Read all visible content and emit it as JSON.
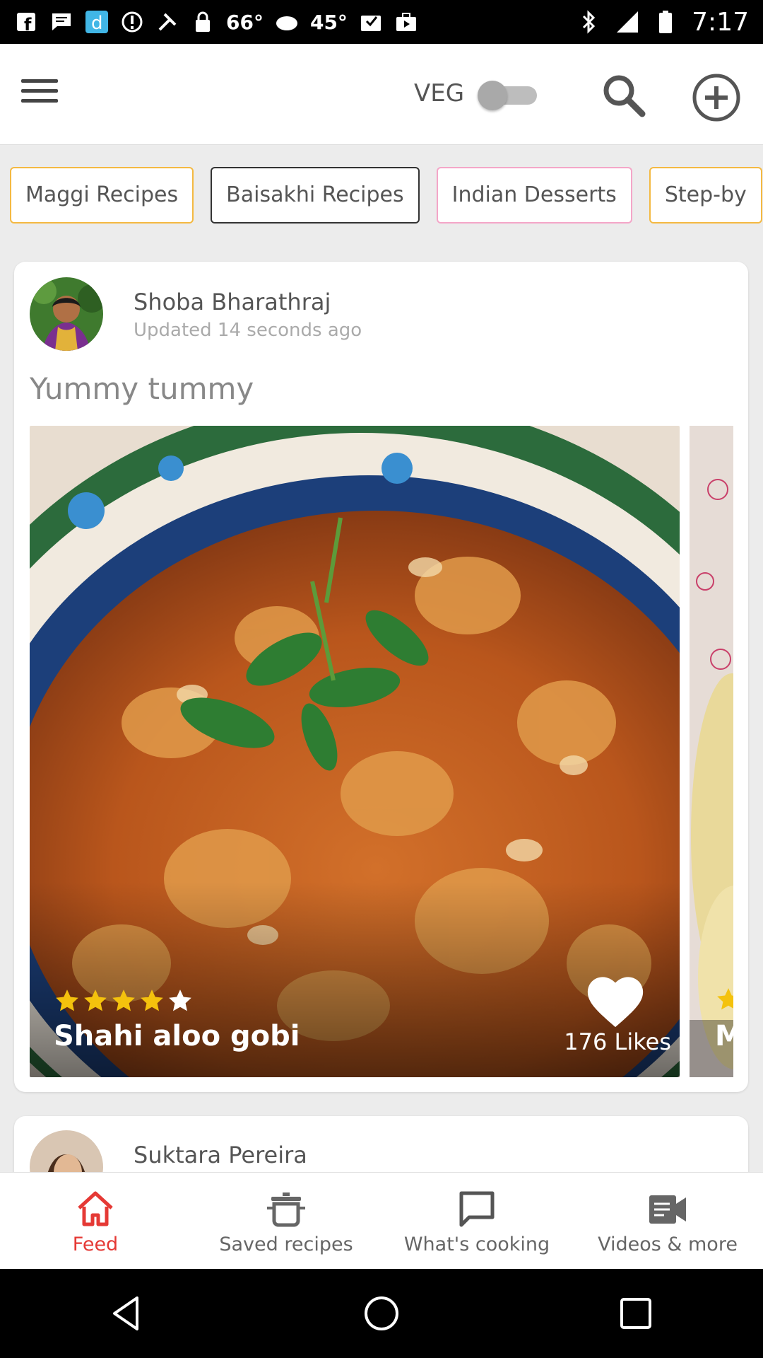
{
  "status_bar": {
    "temp1": "66°",
    "temp2": "45°",
    "time": "7:17"
  },
  "app_bar": {
    "veg_label": "VEG",
    "veg_enabled": false
  },
  "chips": [
    {
      "label": "Maggi Recipes",
      "color": "#f4b942"
    },
    {
      "label": "Baisakhi Recipes",
      "color": "#333333"
    },
    {
      "label": "Indian Desserts",
      "color": "#f4a6c8"
    },
    {
      "label": "Step-by",
      "color": "#f4b942"
    }
  ],
  "feed": {
    "post1": {
      "author": "Shoba Bharathraj",
      "updated": "Updated 14 seconds ago",
      "title": "Yummy tummy",
      "recipe_name": "Shahi aloo gobi",
      "rating": 4,
      "rating_max": 5,
      "likes": "176 Likes",
      "next_recipe_initial": "M"
    },
    "post2": {
      "author": "Suktara Pereira"
    }
  },
  "bottom_nav": [
    {
      "label": "Feed",
      "icon": "home-icon",
      "active": true
    },
    {
      "label": "Saved recipes",
      "icon": "pot-icon",
      "active": false
    },
    {
      "label": "What's cooking",
      "icon": "chat-icon",
      "active": false
    },
    {
      "label": "Videos & more",
      "icon": "video-icon",
      "active": false
    }
  ],
  "colors": {
    "accent": "#e53935",
    "star": "#f4c20d"
  }
}
